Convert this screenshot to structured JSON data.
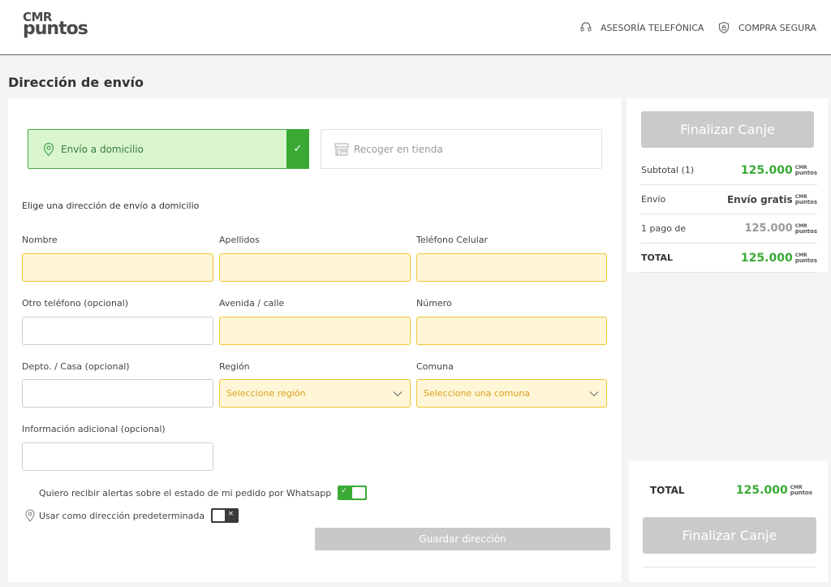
{
  "header": {
    "logo_top": "CMR",
    "logo_bottom": "puntos",
    "phone_link": "ASESORÍA TELEFÓNICA",
    "secure_link": "COMPRA SEGURA"
  },
  "page_title": "Dirección de envío",
  "delivery_options": {
    "home": "Envío a domicilio",
    "store": "Recoger en tienda"
  },
  "form": {
    "subtitle": "Elige una dirección de envío a domicilio",
    "labels": {
      "nombre": "Nombre",
      "apellidos": "Apellidos",
      "telefono": "Teléfono Celular",
      "otro_telefono": "Otro teléfono (opcional)",
      "calle": "Avenida / calle",
      "numero": "Número",
      "depto": "Depto. / Casa (opcional)",
      "region": "Región",
      "comuna": "Comuna",
      "info": "Información adicional (opcional)"
    },
    "region_placeholder": "Seleccione región",
    "comuna_placeholder": "Seleccione una comuna",
    "whatsapp_label": "Quiero recibir alertas sobre el estado de mi pedido por Whatsapp",
    "whatsapp_on": true,
    "default_label": "Usar como dirección predeterminada",
    "default_on": false,
    "save_label": "Guardar dirección"
  },
  "summary": {
    "finalize_label": "Finalizar Canje",
    "rows": [
      {
        "label": "Subtotal (1)",
        "value": "125.000"
      },
      {
        "label": "Envío",
        "value": "Envío gratis"
      },
      {
        "label": "1 pago de",
        "value": "125.000"
      },
      {
        "label": "TOTAL",
        "value": "125.000"
      }
    ],
    "unit_top": "CMR",
    "unit_bottom": "puntos"
  },
  "bottom_summary": {
    "total_label": "TOTAL",
    "total_value": "125.000",
    "finalize_label": "Finalizar Canje"
  },
  "colors": {
    "accent_green": "#3aaa35",
    "required_fill": "#fff6d8",
    "required_border": "#f0c530",
    "disabled_button": "#cacaca"
  }
}
